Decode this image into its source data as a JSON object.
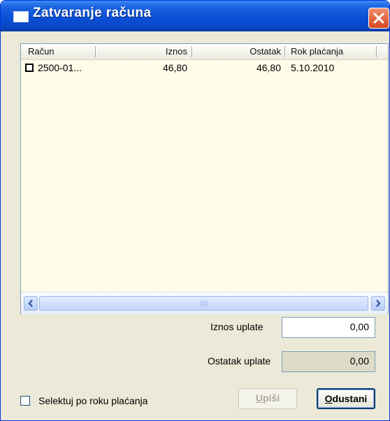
{
  "window": {
    "title": "Zatvaranje računa",
    "close_icon": "close-icon"
  },
  "table": {
    "columns": [
      "Račun",
      "Iznos",
      "Ostatak",
      "Rok plaćanja"
    ],
    "rows": [
      {
        "checked": false,
        "racun": "2500-01...",
        "iznos": "46,80",
        "ostatak": "46,80",
        "rok": "5.10.2010"
      }
    ]
  },
  "form": {
    "iznos_uplate_label": "Iznos uplate",
    "iznos_uplate_value": "0,00",
    "ostatak_uplate_label": "Ostatak uplate",
    "ostatak_uplate_value": "0,00"
  },
  "footer": {
    "checkbox_label": "Selektuj po roku plaćanja",
    "checkbox_checked": false,
    "upisi_mnemonic": "U",
    "upisi_rest": "piši",
    "odustani_mnemonic": "O",
    "odustani_rest": "dustani"
  },
  "colors": {
    "titlebar": "#0a4fd6",
    "list_background": "#fffbe9",
    "dialog_background": "#ece9d8"
  }
}
